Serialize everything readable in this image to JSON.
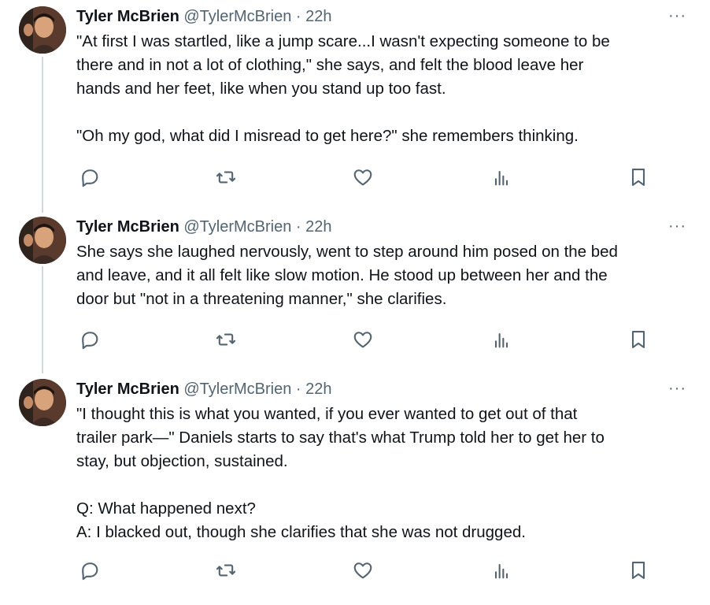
{
  "tweets": [
    {
      "author": "Tyler McBrien",
      "handle": "@TylerMcBrien",
      "separator": "·",
      "time": "22h",
      "more": "···",
      "lines": [
        "\"At first I was startled, like a jump scare...I wasn't expecting someone to be",
        "there and in not a lot of clothing,\" she says, and felt the blood leave her",
        "hands and her feet, like when you stand up too fast.",
        "",
        "\"Oh my god, what did I misread to get here?\" she remembers thinking."
      ]
    },
    {
      "author": "Tyler McBrien",
      "handle": "@TylerMcBrien",
      "separator": "·",
      "time": "22h",
      "more": "···",
      "lines": [
        "She says she laughed nervously, went to step around him posed on the bed",
        "and leave, and it all felt like slow motion. He stood up between her and the",
        "door but \"not in a threatening manner,\" she clarifies."
      ]
    },
    {
      "author": "Tyler McBrien",
      "handle": "@TylerMcBrien",
      "separator": "·",
      "time": "22h",
      "more": "···",
      "lines": [
        "\"I thought this is what you wanted, if you ever wanted to get out of that",
        "trailer park—\" Daniels starts to say that's what Trump told her to get her to",
        "stay, but objection, sustained.",
        "",
        "Q: What happened next?",
        "A: I blacked out, though she clarifies that she was not drugged."
      ]
    }
  ],
  "icons": [
    "reply-icon",
    "retweet-icon",
    "like-icon",
    "views-icon",
    "bookmark-icon"
  ],
  "colors": {
    "text": "#0f1419",
    "secondary": "#536471",
    "thread_line": "#cfd9de"
  }
}
